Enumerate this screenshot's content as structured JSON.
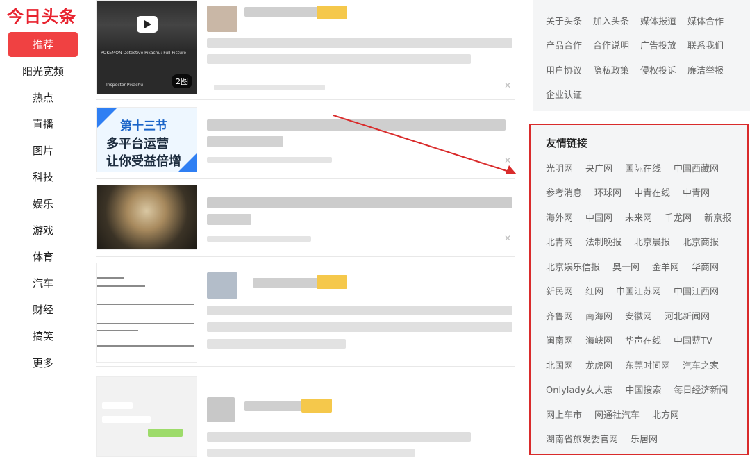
{
  "logo": "今日头条",
  "nav": {
    "items": [
      "推荐",
      "阳光宽频",
      "热点",
      "直播",
      "图片",
      "科技",
      "娱乐",
      "游戏",
      "体育",
      "汽车",
      "财经",
      "搞笑",
      "更多"
    ],
    "active_index": 0
  },
  "feed": {
    "item1": {
      "video_caption": "POKEMON Detective Pikachu: Full Picture",
      "badge": "2图",
      "channel": "Inspector Pikachu"
    },
    "item2": {
      "promo_line1": "第十三节",
      "promo_line2": "多平台运营",
      "promo_line3": "让你受益倍增"
    }
  },
  "about": {
    "rows": [
      [
        "关于头条",
        "加入头条",
        "媒体报道",
        "媒体合作"
      ],
      [
        "产品合作",
        "合作说明",
        "广告投放",
        "联系我们"
      ],
      [
        "用户协议",
        "隐私政策",
        "侵权投诉",
        "廉洁举报"
      ],
      [
        "企业认证"
      ]
    ]
  },
  "friend_links": {
    "title": "友情链接",
    "rows": [
      [
        "光明网",
        "央广网",
        "国际在线",
        "中国西藏网"
      ],
      [
        "参考消息",
        "环球网",
        "中青在线",
        "中青网"
      ],
      [
        "海外网",
        "中国网",
        "未来网",
        "千龙网",
        "新京报"
      ],
      [
        "北青网",
        "法制晚报",
        "北京晨报",
        "北京商报"
      ],
      [
        "北京娱乐信报",
        "奥一网",
        "金羊网",
        "华商网"
      ],
      [
        "新民网",
        "红网",
        "中国江苏网",
        "中国江西网"
      ],
      [
        "齐鲁网",
        "南海网",
        "安徽网",
        "河北新闻网"
      ],
      [
        "闽南网",
        "海峡网",
        "华声在线",
        "中国蓝TV"
      ],
      [
        "北国网",
        "龙虎网",
        "东莞时间网",
        "汽车之家"
      ],
      [
        "Onlylady女人志",
        "中国搜索",
        "每日经济新闻"
      ],
      [
        "网上车市",
        "网通社汽车",
        "北方网"
      ],
      [
        "湖南省旅发委官网",
        "乐居网"
      ]
    ]
  },
  "colors": {
    "brand_red": "#e8232f",
    "active_nav": "#f04142",
    "highlight_border": "#d92b2b"
  }
}
